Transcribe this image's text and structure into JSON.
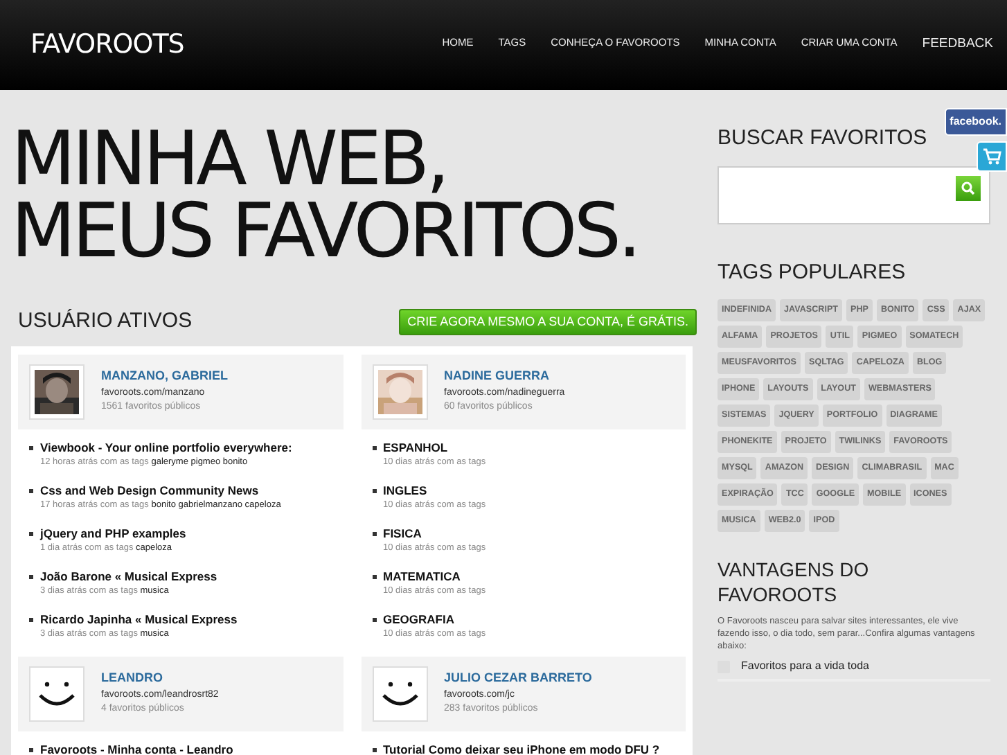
{
  "navbar": {
    "brand": "FAVOROOTS",
    "items": [
      {
        "label": "HOME"
      },
      {
        "label": "TAGS"
      },
      {
        "label": "CONHEÇA O FAVOROOTS"
      },
      {
        "label": "MINHA CONTA"
      },
      {
        "label": "CRIAR UMA CONTA"
      },
      {
        "label": "FEEDBACK"
      }
    ]
  },
  "side_tabs": [
    {
      "kind": "facebook",
      "label": "facebook."
    },
    {
      "kind": "cart"
    }
  ],
  "hero": {
    "lines": [
      "MINHA WEB,",
      "MEUS FAVORITOS."
    ]
  },
  "active_users": {
    "title": "USUÁRIO ATIVOS",
    "cta": "CRIE AGORA MESMO A SUA CONTA, É GRÁTIS.",
    "users": [
      {
        "name": "MANZANO, GABRIEL",
        "url": "favoroots.com/manzano",
        "count": "1561 favoritos públicos",
        "bookmarks": [
          {
            "title": "Viewbook - Your online portfolio everywhere:",
            "meta": "12 horas atrás com as tags",
            "tags": "galeryme pigmeo bonito"
          },
          {
            "title": "Css and Web Design Community News",
            "meta": "17 horas atrás com as tags",
            "tags": "bonito gabrielmanzano capeloza"
          },
          {
            "title": "jQuery and PHP examples",
            "meta": "1 dia atrás com as tags",
            "tags": "capeloza"
          },
          {
            "title": "João Barone « Musical Express",
            "meta": "3 dias atrás com as tags",
            "tags": "musica"
          },
          {
            "title": "Ricardo Japinha « Musical Express",
            "meta": "3 dias atrás com as tags",
            "tags": "musica"
          }
        ]
      },
      {
        "name": "NADINE GUERRA",
        "url": "favoroots.com/nadineguerra",
        "count": "60 favoritos públicos",
        "bookmarks": [
          {
            "title": "ESPANHOL",
            "meta": "10 dias atrás com as tags"
          },
          {
            "title": "INGLES",
            "meta": "10 dias atrás com as tags"
          },
          {
            "title": "FISICA",
            "meta": "10 dias atrás com as tags"
          },
          {
            "title": "MATEMATICA",
            "meta": "10 dias atrás com as tags"
          },
          {
            "title": "GEOGRAFIA",
            "meta": "10 dias atrás com as tags"
          }
        ]
      },
      {
        "name": "LEANDRO",
        "url": "favoroots.com/leandrosrt82",
        "count": "4 favoritos públicos",
        "kind": "smiley",
        "bookmarks": [
          {
            "title": "Favoroots - Minha conta - Leandro"
          }
        ]
      },
      {
        "name": "JULIO CEZAR BARRETO",
        "url": "favoroots.com/jc",
        "count": "283 favoritos públicos",
        "kind": "smiley",
        "bookmarks": [
          {
            "title": "Tutorial Como deixar seu iPhone em modo DFU ?"
          }
        ]
      }
    ]
  },
  "search": {
    "title": "BUSCAR FAVORITOS"
  },
  "popular_tags": {
    "title": "TAGS POPULARES",
    "tags": [
      "INDEFINIDA",
      "JAVASCRIPT",
      "PHP",
      "BONITO",
      "CSS",
      "AJAX",
      "ALFAMA",
      "PROJETOS",
      "UTIL",
      "PIGMEO",
      "SOMATECH",
      "MEUSFAVORITOS",
      "SQLTAG",
      "CAPELOZA",
      "BLOG",
      "IPHONE",
      "LAYOUTS",
      "LAYOUT",
      "WEBMASTERS",
      "SISTEMAS",
      "JQUERY",
      "PORTFOLIO",
      "DIAGRAME",
      "PHONEKITE",
      "PROJETO",
      "TWILINKS",
      "FAVOROOTS",
      "MYSQL",
      "AMAZON",
      "DESIGN",
      "CLIMABRASIL",
      "MAC",
      "EXPIRAÇÃO",
      "TCC",
      "GOOGLE",
      "MOBILE",
      "ICONES",
      "MUSICA",
      "WEB2.0",
      "IPOD"
    ]
  },
  "advantages": {
    "title": "VANTAGENS DO FAVOROOTS",
    "text": "O Favoroots nasceu para salvar sites interessantes, ele vive fazendo isso, o dia todo, sem parar...Confira algumas vantagens abaixo:",
    "items": [
      "Favoritos para a vida toda"
    ]
  }
}
